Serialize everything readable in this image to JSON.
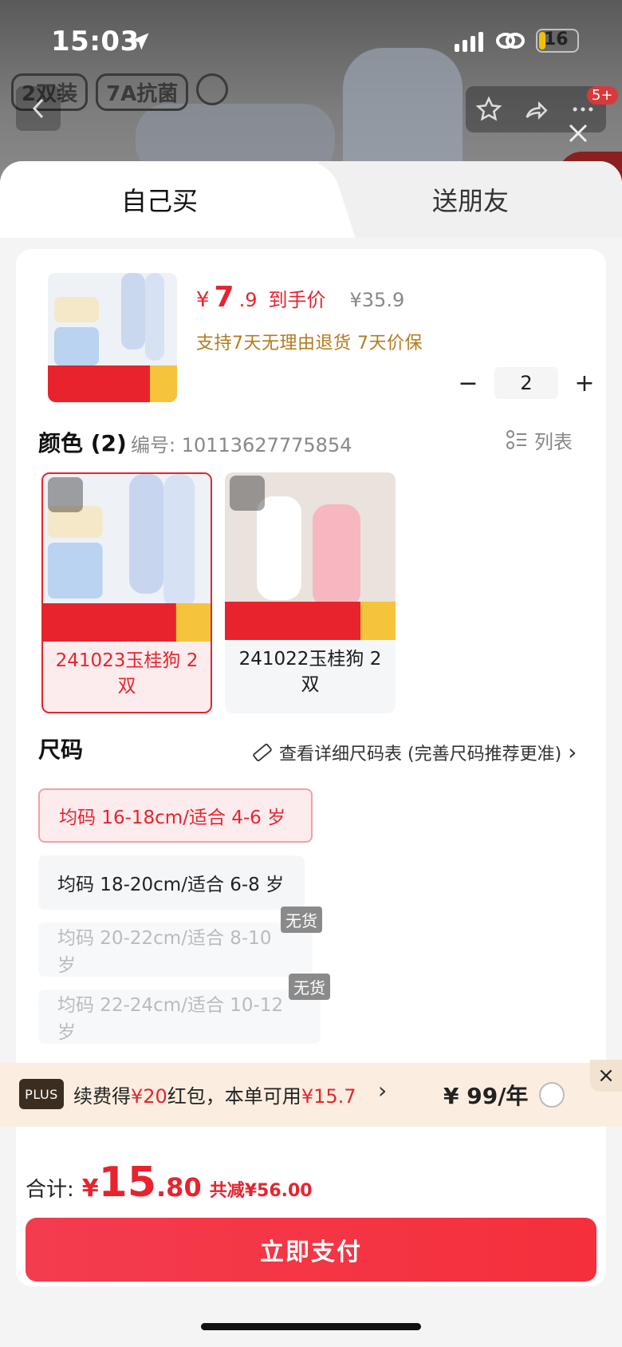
{
  "status_bar": {
    "time": "15:03",
    "battery": "16"
  },
  "product_tags": [
    "2双装",
    "7A抗菌"
  ],
  "header": {
    "badge": "5+"
  },
  "tabs": {
    "self_buy": "自己买",
    "gift": "送朋友"
  },
  "product": {
    "price_symbol": "¥",
    "price_int": "7",
    "price_dec": ".9",
    "price_label": "到手价",
    "original_price": "¥35.9",
    "returns": "支持7天无理由退货  7天价保",
    "quantity": "2",
    "minus": "−",
    "plus": "+"
  },
  "color": {
    "title": "颜色 (2)",
    "code": "编号: 10113627775854",
    "list_view": "列表",
    "options": [
      {
        "label": "241023玉桂狗 2双",
        "selected": true
      },
      {
        "label": "241022玉桂狗 2双",
        "selected": false
      }
    ]
  },
  "size": {
    "title": "尺码",
    "chart_link": "查看详细尺码表 (完善尺码推荐更准)",
    "chevron": "›",
    "options": [
      {
        "label": "均码 16-18cm/适合 4-6 岁",
        "state": "selected"
      },
      {
        "label": "均码 18-20cm/适合 6-8 岁",
        "state": "normal"
      },
      {
        "label": "均码 20-22cm/适合 8-10 岁",
        "state": "out_of_stock"
      },
      {
        "label": "均码 22-24cm/适合 10-12 岁",
        "state": "out_of_stock"
      }
    ],
    "out_of_stock_label": "无货"
  },
  "plus_banner": {
    "badge": "PLUS",
    "text_a": "续费得",
    "text_b": "¥20",
    "text_c": "红包，本单可用",
    "text_d": "¥15.7",
    "arrow": "›",
    "price": "¥ 99/年",
    "close": "×"
  },
  "total": {
    "label": "合计:",
    "symbol": "¥",
    "int": "15",
    "dec": ".80",
    "reduction": "共减¥56.00"
  },
  "pay_button": "立即支付",
  "colors": {
    "accent": "#e8232e",
    "gold": "#b37b1f",
    "plus_bg": "#fbeee0"
  }
}
